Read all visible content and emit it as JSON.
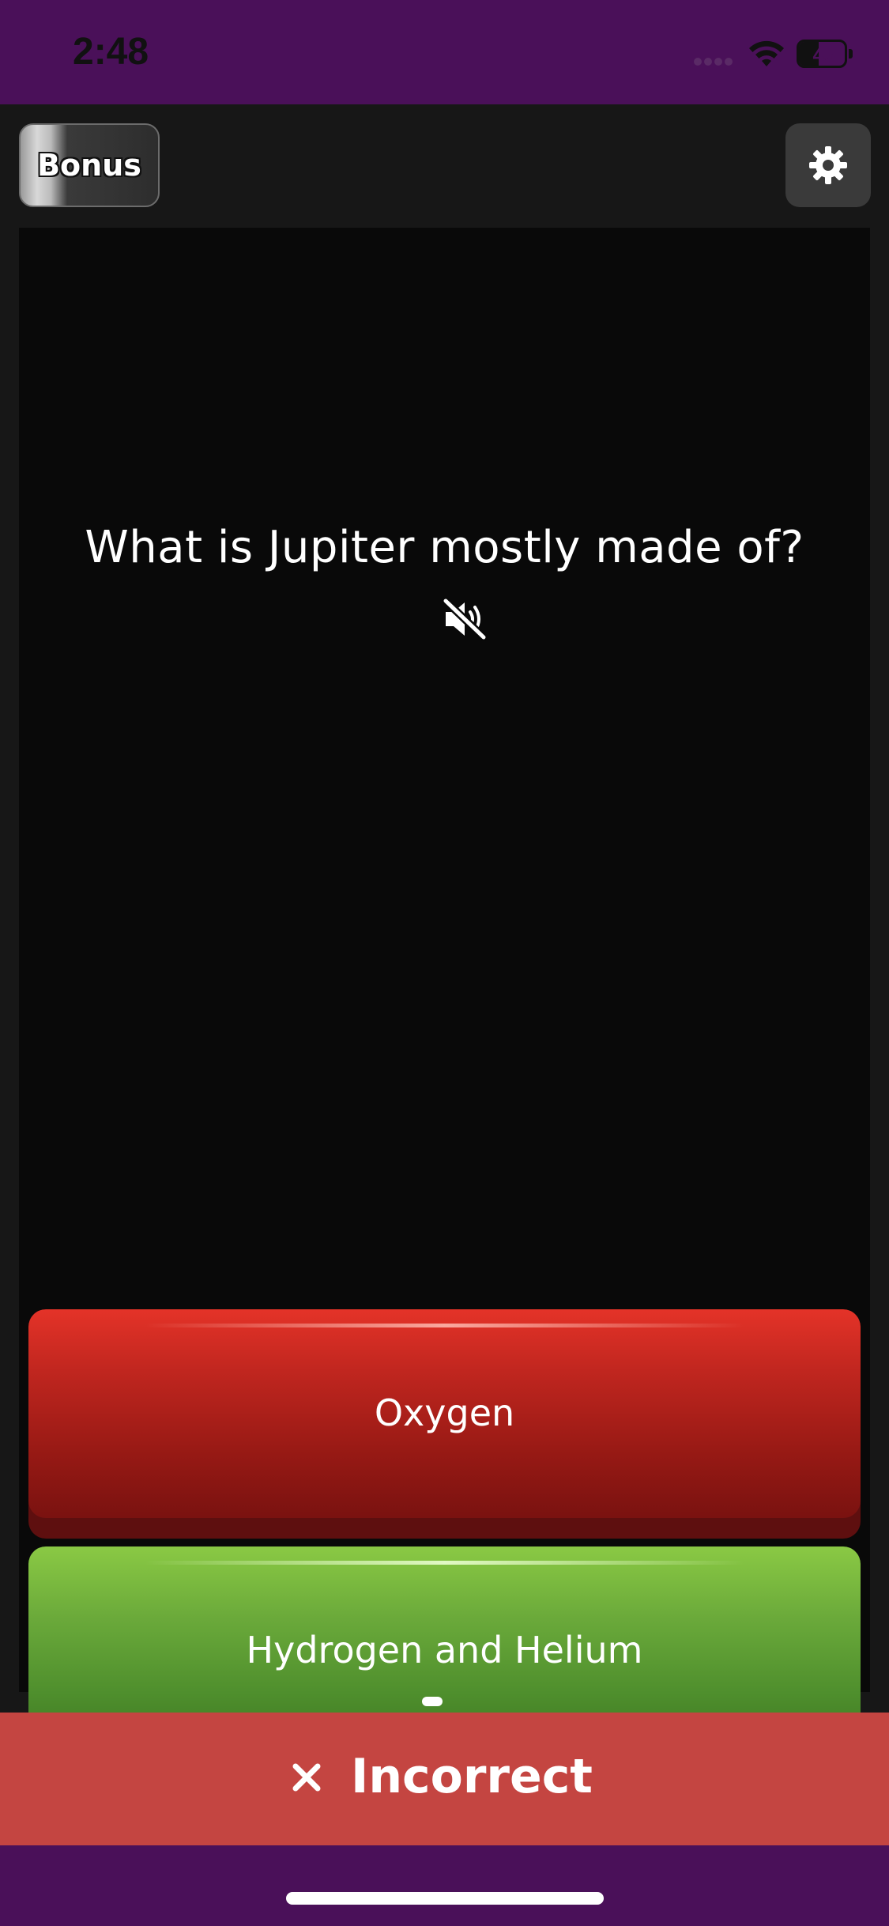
{
  "status_bar": {
    "time": "2:48",
    "battery_level": "43",
    "battery_fraction": 0.43
  },
  "header": {
    "bonus_label": "Bonus",
    "settings_icon": "gear-icon"
  },
  "question": {
    "text": "What is Jupiter mostly made of?",
    "audio_icon": "speaker-muted-icon"
  },
  "answers": [
    {
      "label": "Oxygen",
      "state": "incorrect",
      "color": "#c0261f"
    },
    {
      "label": "Hydrogen and Helium",
      "state": "correct",
      "color": "#6aa93a"
    }
  ],
  "result": {
    "icon": "close-icon",
    "label": "Incorrect",
    "color": "#c44541"
  },
  "colors": {
    "accent": "#4a1059",
    "background": "#171717",
    "panel": "#090909"
  }
}
